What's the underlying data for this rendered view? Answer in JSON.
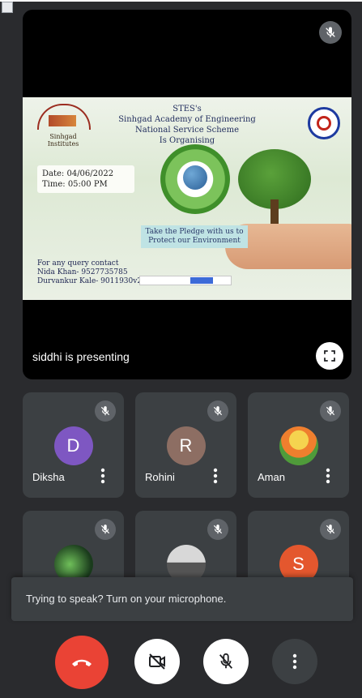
{
  "presenter": {
    "status_text": "siddhi is presenting",
    "slide": {
      "institute_logo_text": "Sinhgad Institutes",
      "title_lines": [
        "STES's",
        "Sinhgad Academy of Engineering",
        "National Service Scheme",
        "Is Organising"
      ],
      "date_line": "Date: 04/06/2022",
      "time_line": "Time: 05:00 PM",
      "pledge_lines": [
        "Take the Pledge with us to",
        "Protect our Environment"
      ],
      "query_lines": [
        "For any query contact",
        "Nida Khan- 9527735785",
        "Durvankur Kale- 9011930v28"
      ]
    }
  },
  "participants": [
    {
      "name": "Diksha",
      "initial": "D",
      "avatar_color": "#7e57c2",
      "muted": true
    },
    {
      "name": "Rohini",
      "initial": "R",
      "avatar_color": "#8d6e63",
      "muted": true
    },
    {
      "name": "Aman",
      "initial": "",
      "avatar_color": "",
      "muted": true
    },
    {
      "name": "",
      "initial": "",
      "avatar_color": "",
      "muted": true
    },
    {
      "name": "",
      "initial": "",
      "avatar_color": "",
      "muted": true
    },
    {
      "name": "",
      "initial": "S",
      "avatar_color": "#e4572e",
      "muted": true
    }
  ],
  "toast": {
    "message": "Trying to speak? Turn on your microphone."
  },
  "controls": {
    "end_call_color": "#ea4335",
    "icons": [
      "phone-hangup-icon",
      "camera-off-icon",
      "mic-off-icon",
      "more-vert-icon"
    ]
  }
}
